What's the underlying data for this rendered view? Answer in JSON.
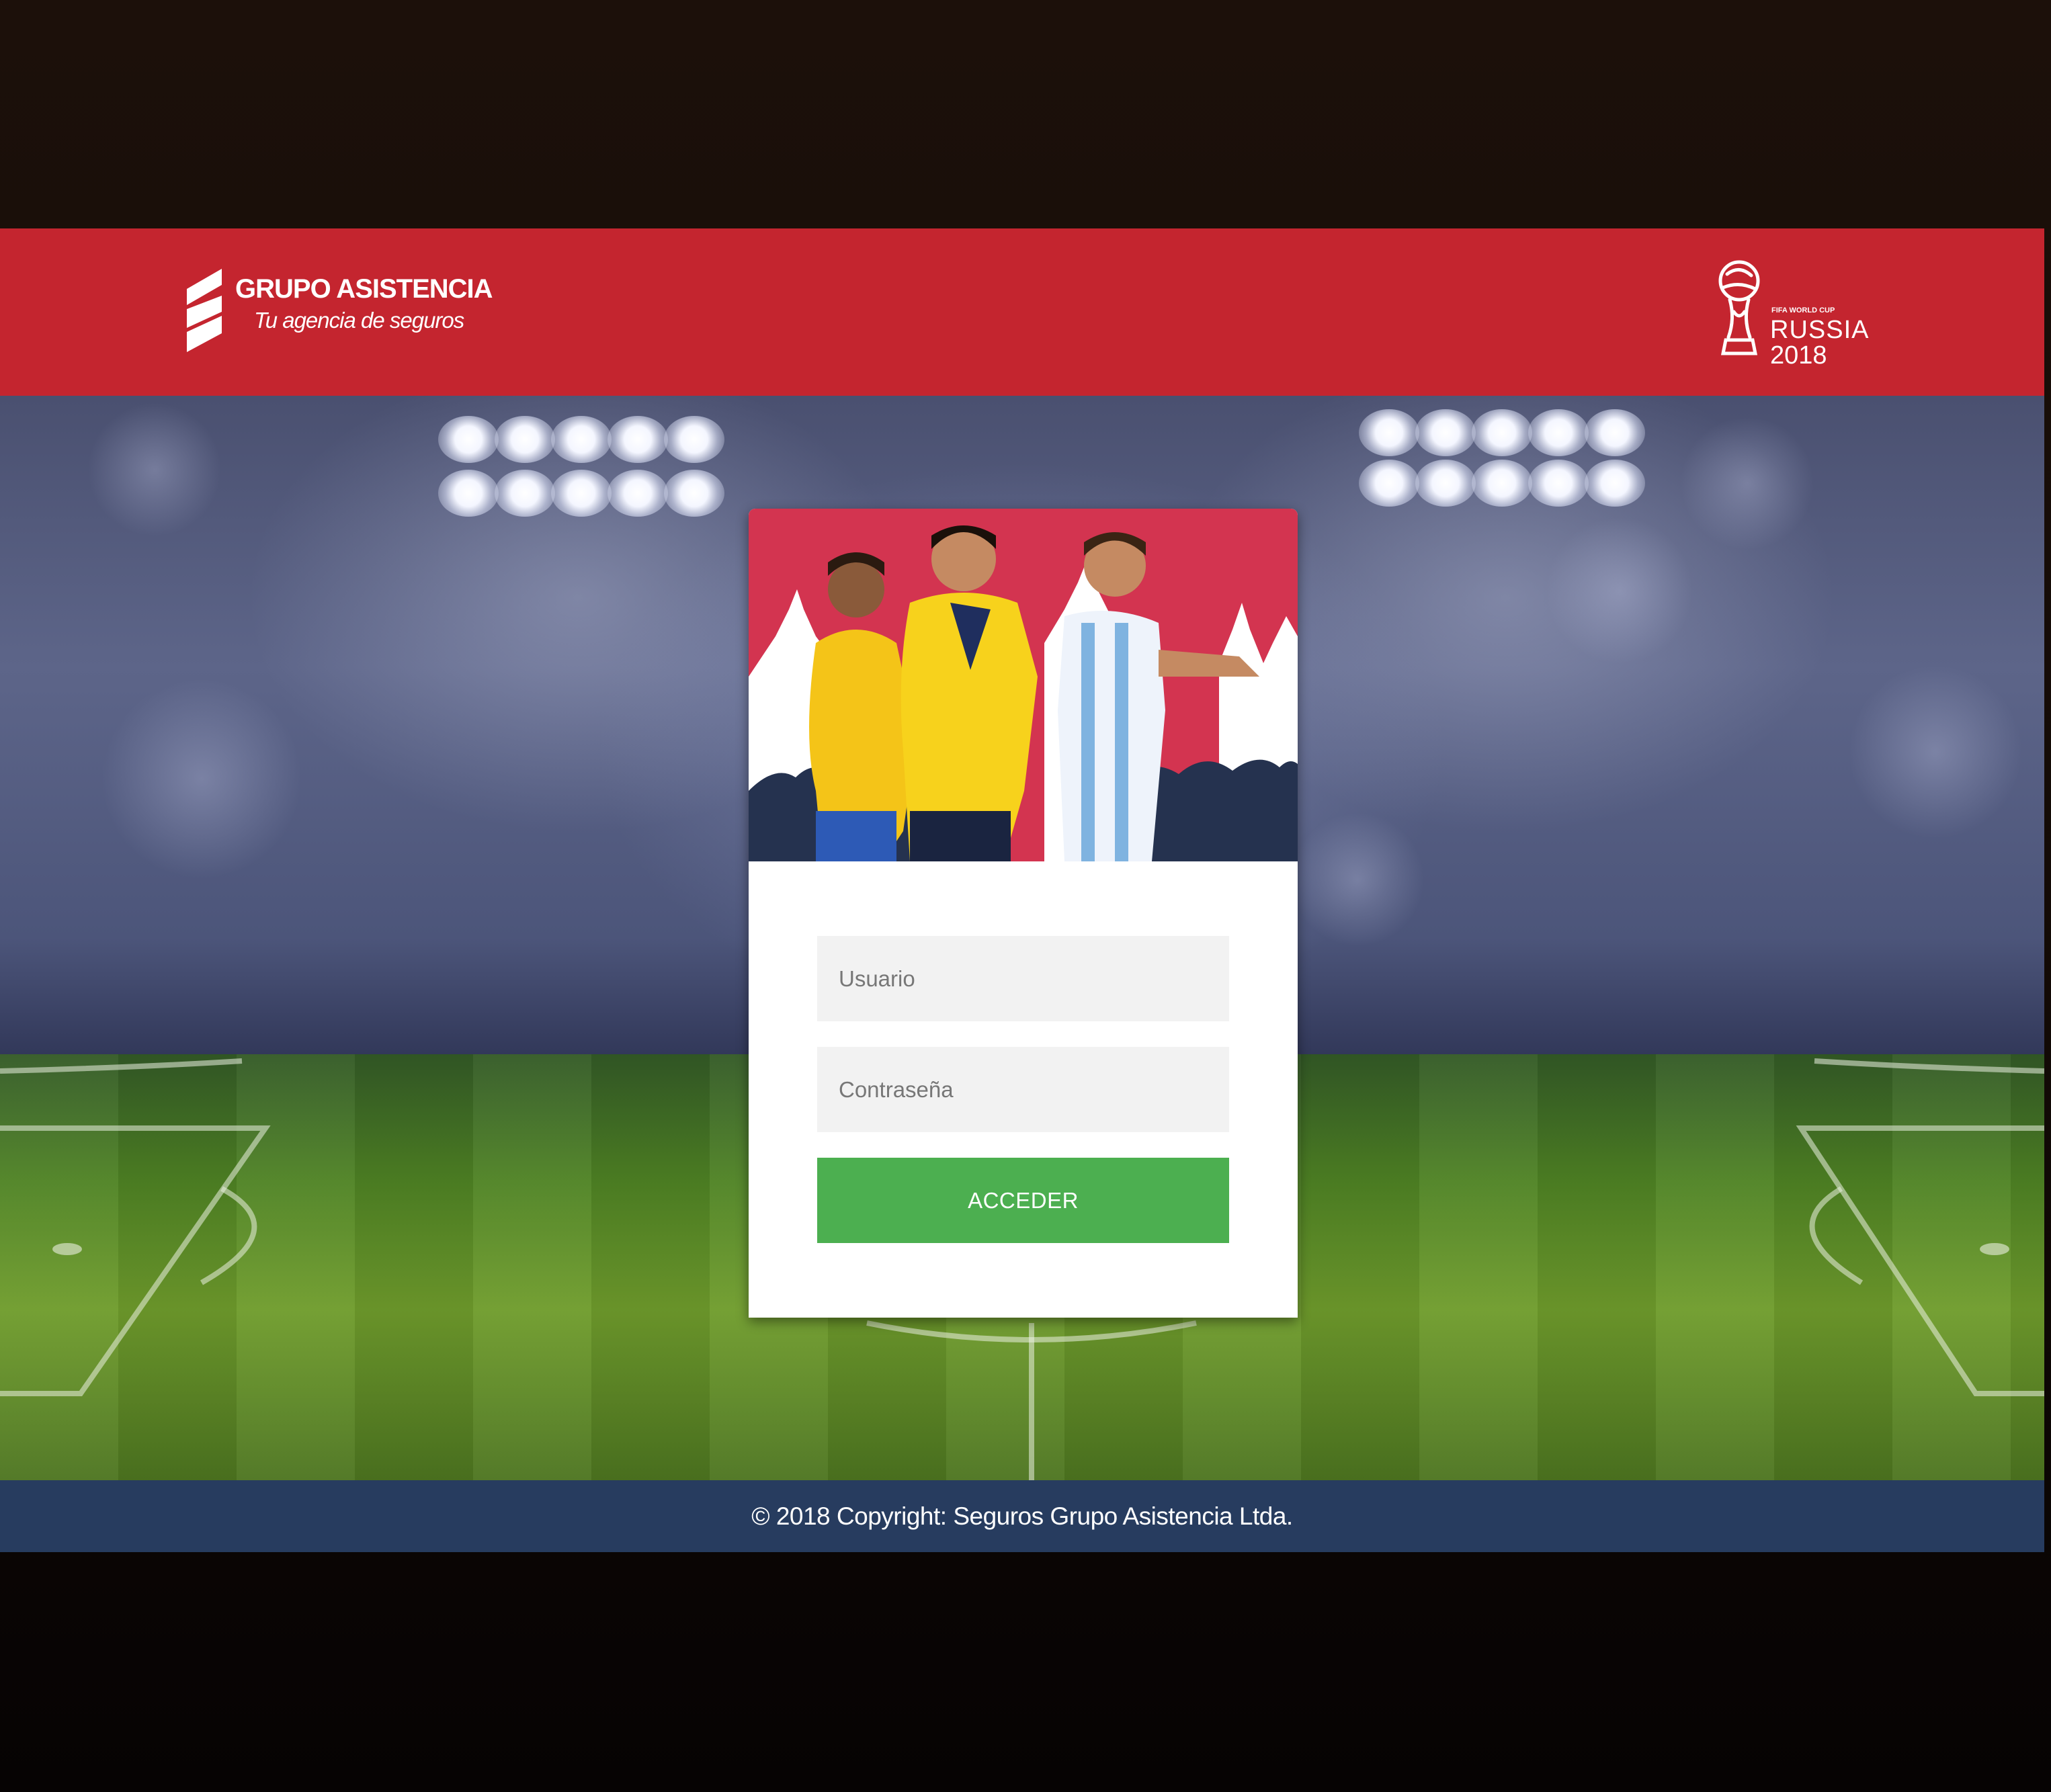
{
  "brand": {
    "name": "GRUPO ASISTENCIA",
    "tagline": "Tu agencia de seguros"
  },
  "event_logo": {
    "small_text": "FIFA WORLD CUP",
    "country": "RUSSIA",
    "year": "2018"
  },
  "login": {
    "username_placeholder": "Usuario",
    "password_placeholder": "Contraseña",
    "submit_label": "ACCEDER"
  },
  "footer": {
    "copyright": "© 2018 Copyright: Seguros Grupo Asistencia Ltda."
  },
  "colors": {
    "header_red": "#c4252f",
    "button_green": "#4caf50",
    "footer_navy": "#273c5f",
    "banner_pink": "#d33450"
  },
  "icons": {
    "brand_mark": "grupo-asistencia-s-logo",
    "event_mark": "world-cup-trophy-icon"
  }
}
